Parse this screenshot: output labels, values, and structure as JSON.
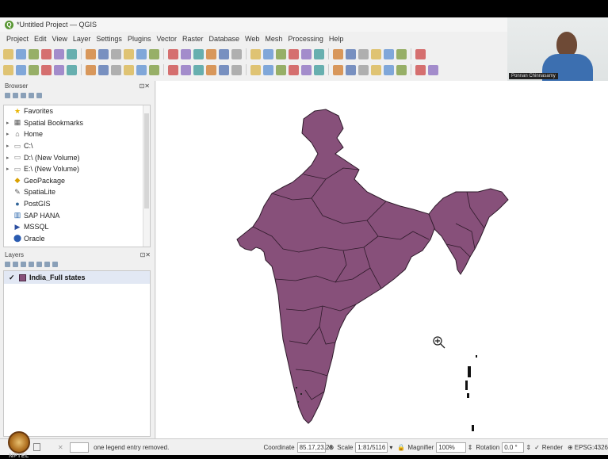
{
  "window": {
    "title": "*Untitled Project — QGIS"
  },
  "menu": [
    "Project",
    "Edit",
    "View",
    "Layer",
    "Settings",
    "Plugins",
    "Vector",
    "Raster",
    "Database",
    "Web",
    "Mesh",
    "Processing",
    "Help"
  ],
  "browser": {
    "title": "Browser",
    "items": [
      {
        "label": "Favorites",
        "icon": "star-icon",
        "color": "#e8b400"
      },
      {
        "label": "Spatial Bookmarks",
        "icon": "bookmark-icon",
        "color": "#555555"
      },
      {
        "label": "Home",
        "icon": "home-icon",
        "color": "#555555"
      },
      {
        "label": "C:\\",
        "icon": "folder-icon",
        "color": "#888888"
      },
      {
        "label": "D:\\ (New Volume)",
        "icon": "folder-icon",
        "color": "#888888"
      },
      {
        "label": "E:\\ (New Volume)",
        "icon": "folder-icon",
        "color": "#888888"
      },
      {
        "label": "GeoPackage",
        "icon": "geopackage-icon",
        "color": "#d9a000"
      },
      {
        "label": "SpatiaLite",
        "icon": "spatialite-icon",
        "color": "#555555"
      },
      {
        "label": "PostGIS",
        "icon": "postgis-icon",
        "color": "#336699"
      },
      {
        "label": "SAP HANA",
        "icon": "sap-hana-icon",
        "color": "#1f5fa8"
      },
      {
        "label": "MSSQL",
        "icon": "mssql-icon",
        "color": "#2b4ea0"
      },
      {
        "label": "Oracle",
        "icon": "oracle-icon",
        "color": "#2a5bb0"
      }
    ]
  },
  "layers": {
    "title": "Layers",
    "items": [
      {
        "label": "India_Full states",
        "checked": true,
        "color": "#87507a"
      }
    ]
  },
  "map": {
    "fill": "#87507a",
    "stroke": "#2e1a2a"
  },
  "status": {
    "message": "one legend entry removed.",
    "coordinate_label": "Coordinate",
    "coordinate": "85.17,23.26",
    "scale_label": "Scale",
    "scale": "1:81/5116",
    "magnifier_label": "Magnifier",
    "magnifier": "100%",
    "rotation_label": "Rotation",
    "rotation": "0.0 °",
    "render_label": "Render",
    "crs": "EPSG:4326"
  },
  "webcam": {
    "name": "Ponnan Chinnasamy"
  },
  "watermark": "NPTEL"
}
